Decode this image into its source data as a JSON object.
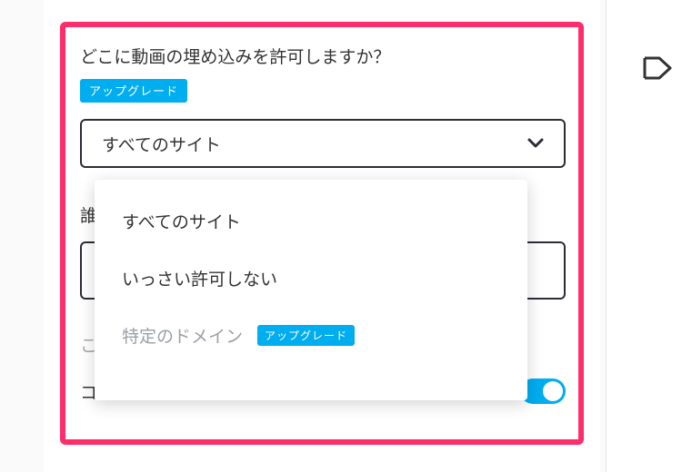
{
  "section1": {
    "title": "どこに動画の埋め込みを許可しますか？",
    "upgrade_label": "アップグレード",
    "select": {
      "selected": "すべてのサイト",
      "options": [
        {
          "label": "すべてのサイト",
          "disabled": false
        },
        {
          "label": "いっさい許可しない",
          "disabled": false
        },
        {
          "label": "特定のドメイン",
          "disabled": true,
          "upgrade": "アップグレード"
        }
      ]
    }
  },
  "section2": {
    "title_fragment": "誰",
    "partial_label": "こ"
  },
  "toggle_row": {
    "label": "コレクションへの追加を許可する",
    "on": true
  },
  "colors": {
    "highlight": "#ff2d6b",
    "accent": "#00adef"
  }
}
